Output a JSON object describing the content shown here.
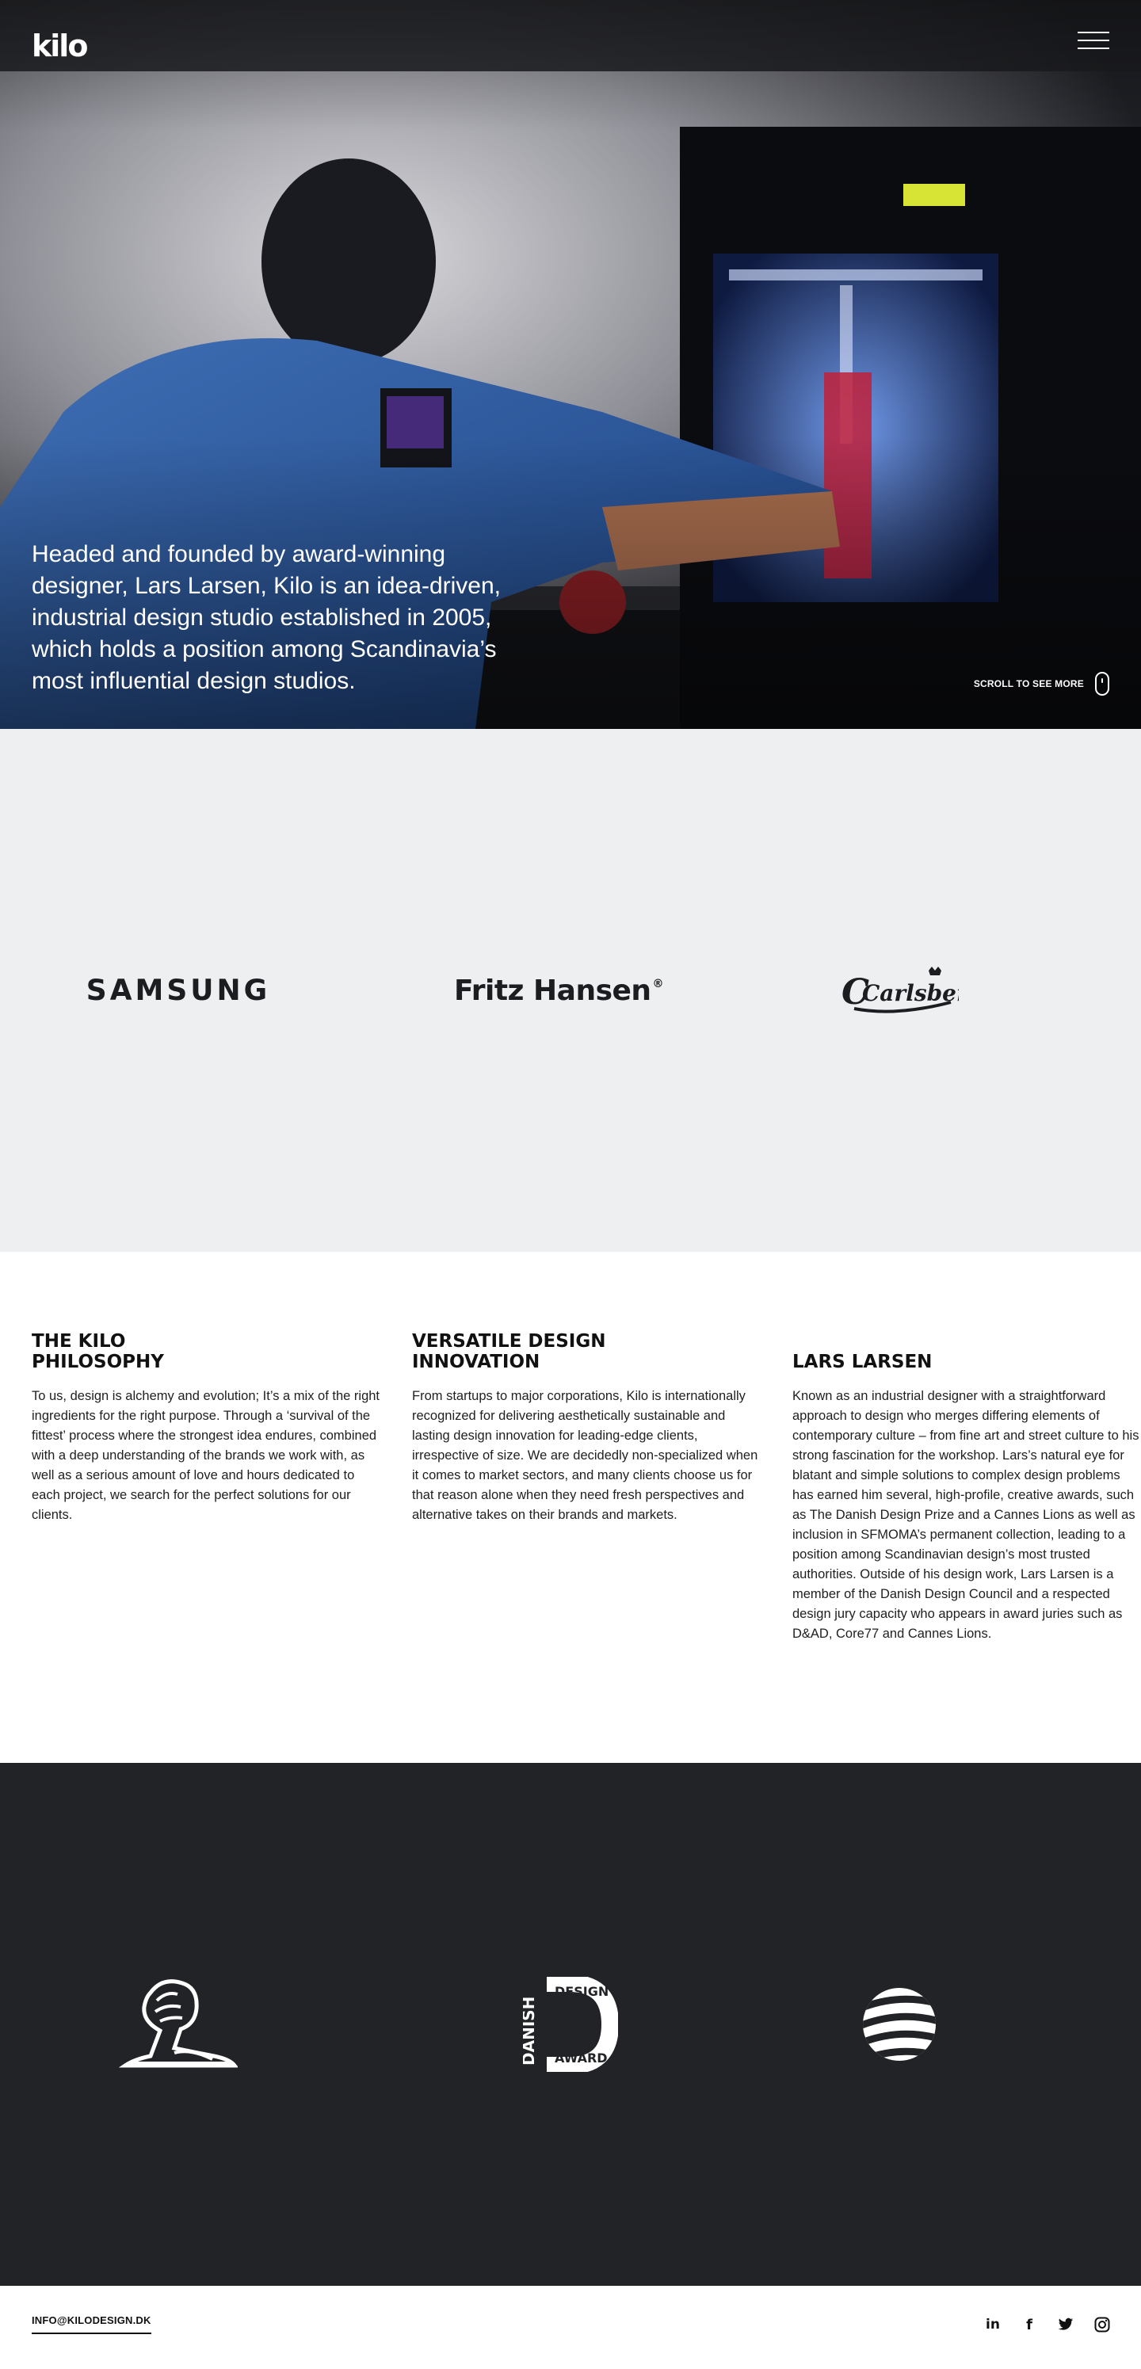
{
  "header": {
    "logo": "kilo",
    "menu_icon": "hamburger-menu-icon"
  },
  "hero": {
    "text": "Headed and founded by award-winning designer, Lars Larsen, Kilo is an idea-driven, industrial design studio established in 2005, which holds a position among Scandinavia’s most influential design studios.",
    "scroll_label": "SCROLL TO SEE MORE",
    "scroll_icon": "mouse-scroll-icon"
  },
  "clients": [
    {
      "name": "SAMSUNG"
    },
    {
      "name": "Fritz Hansen",
      "mark": "®"
    },
    {
      "name": "Carlsberg"
    }
  ],
  "info": [
    {
      "title": "THE KILO\nPHILOSOPHY",
      "body": "To us, design is alchemy and evolution; It’s a mix of the right ingredients for the right purpose. Through a ‘survival of the fittest’ process where the strongest idea endures, combined with a deep understanding of the brands we work with, as well as a serious amount of love and hours dedicated to each project, we search for the perfect solutions for our clients."
    },
    {
      "title": "VERSATILE DESIGN\nINNOVATION",
      "body": "From startups to major corporations, Kilo is internationally recognized for delivering aesthetically sustainable and lasting design innovation for leading-edge clients, irrespective of size. We are decidedly non-specialized when it comes to market sectors, and many clients choose us for that reason alone when they need fresh perspectives and alternative takes on their brands and markets."
    },
    {
      "title": "LARS LARSEN",
      "body": "Known as an industrial designer with a straightforward approach to design who merges differing elements of contemporary culture – from fine art and street culture to his strong fascination for the workshop. Lars’s natural eye for blatant and simple solutions to complex design problems has earned him several, high-profile, creative awards, such as The Danish Design Prize and a Cannes Lions as well as inclusion in SFMOMA’s permanent collection, leading to a position among Scandinavian design’s most trusted authorities. Outside of his design work, Lars Larsen is a member of the Danish Design Council and a respected design jury capacity who appears in award juries such as D&AD, Core77 and Cannes Lions."
    }
  ],
  "awards": {
    "danish_design_award": {
      "line1": "DANISH",
      "line2": "DESIGN",
      "line3": "AWARD"
    },
    "icons": [
      "cannes-lions-icon",
      "danish-design-award-icon",
      "red-dot-icon"
    ]
  },
  "footer": {
    "email": "INFO@KILODESIGN.DK",
    "socials": [
      "linkedin-icon",
      "facebook-icon",
      "twitter-icon",
      "instagram-icon"
    ],
    "social_labels": {
      "linkedin": "in",
      "facebook": "f"
    }
  },
  "colors": {
    "clients_bg": "#eeeff1",
    "awards_bg": "#222326",
    "text_dark": "#111111"
  }
}
